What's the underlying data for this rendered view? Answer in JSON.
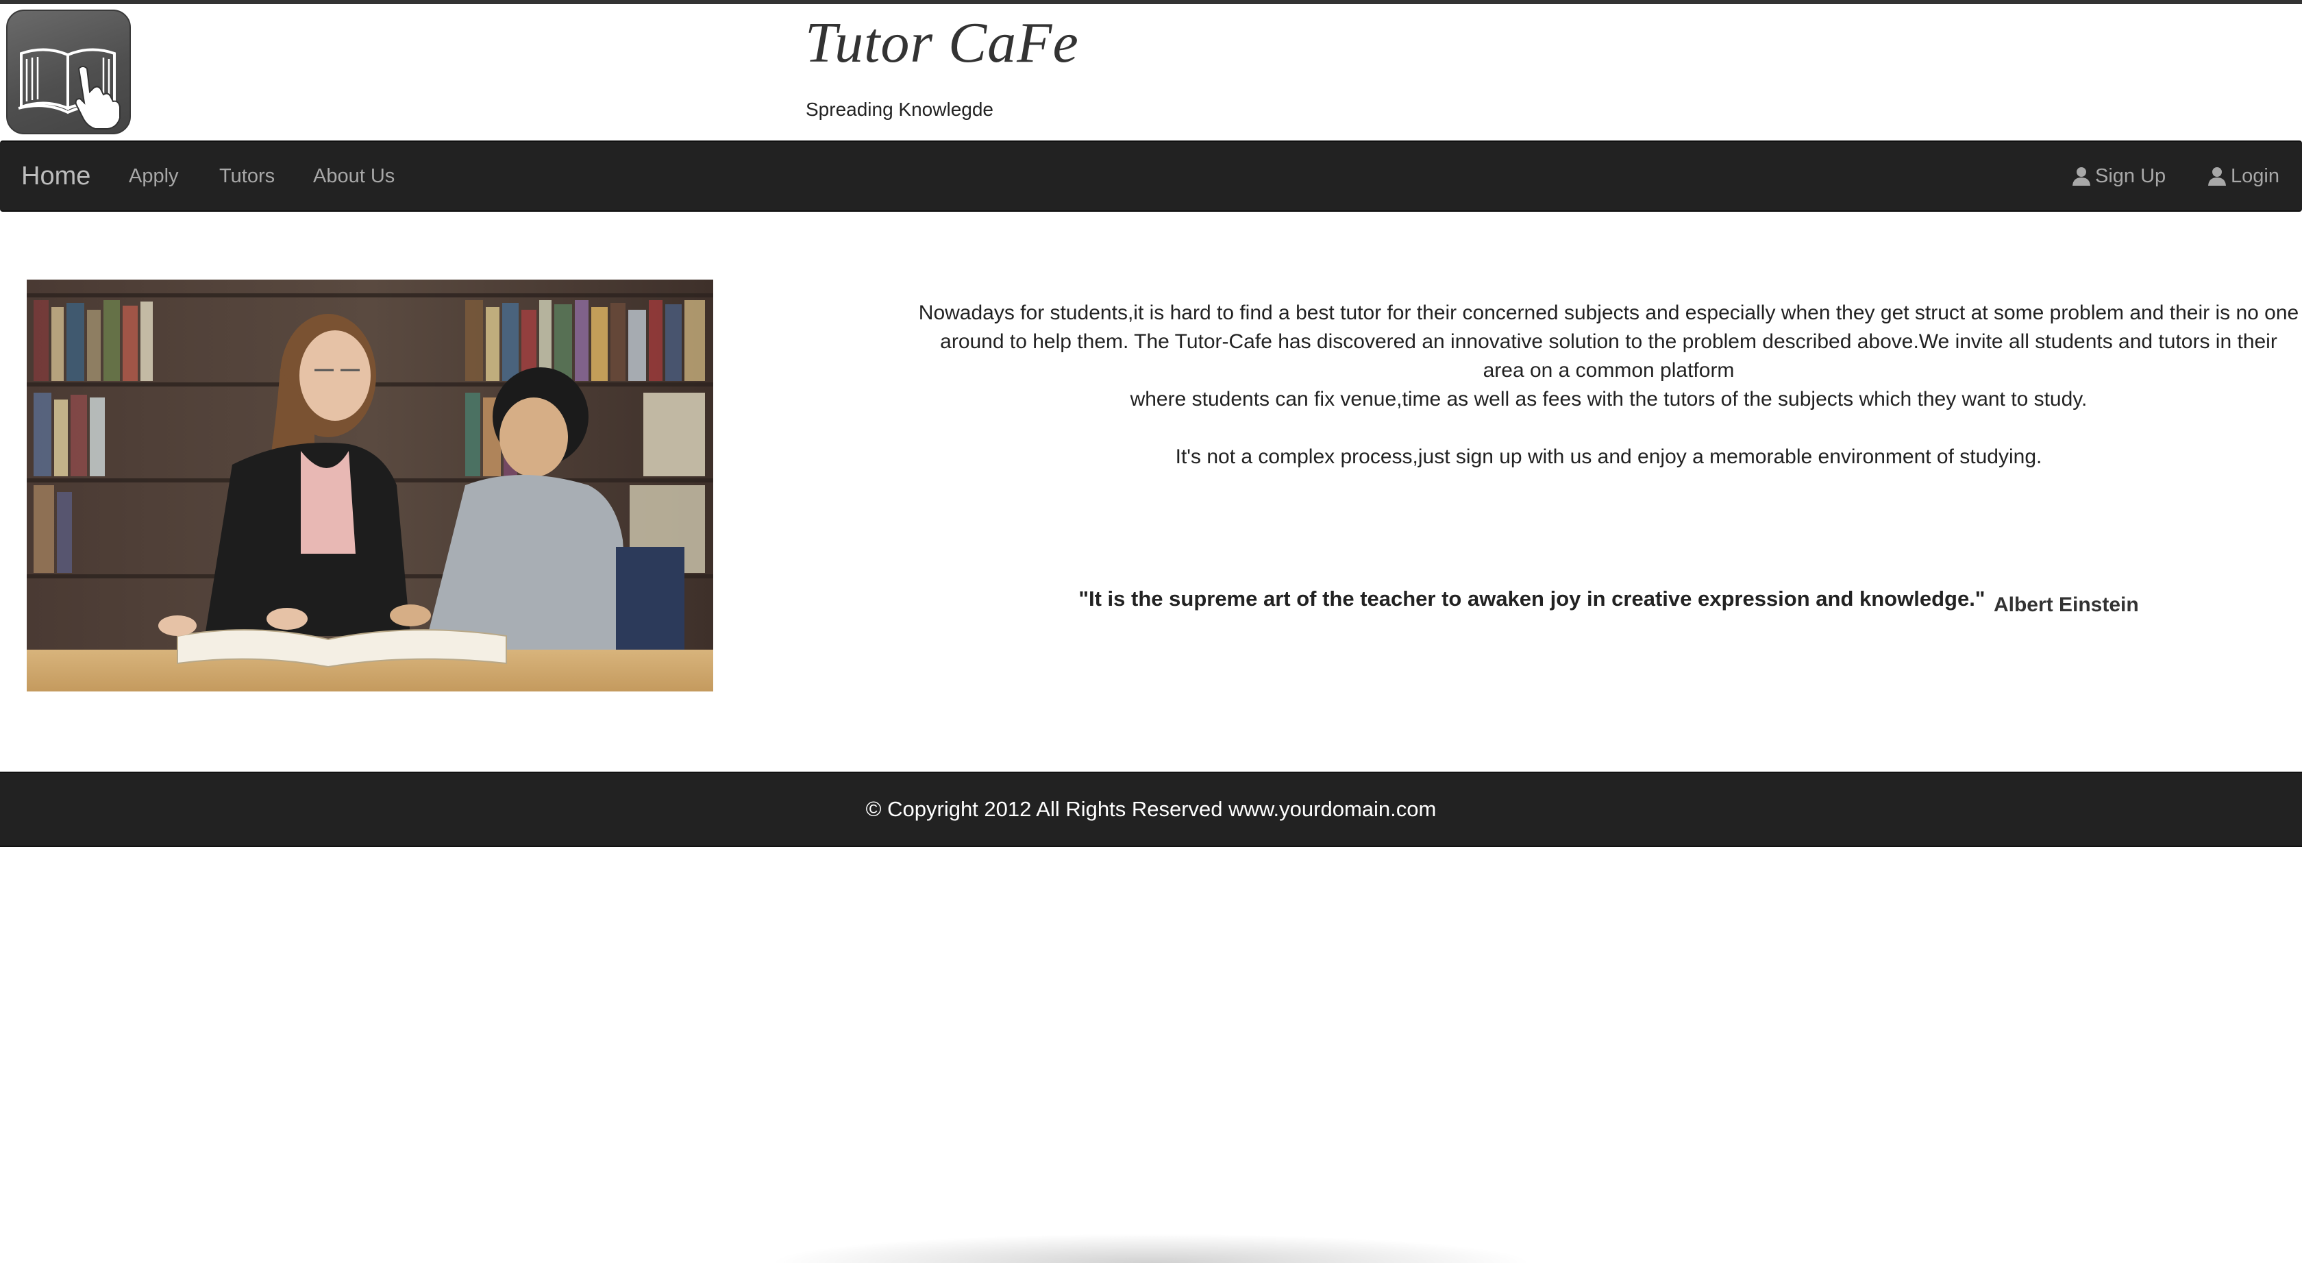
{
  "header": {
    "title": "Tutor CaFe",
    "tagline": "Spreading Knowlegde",
    "logo_icon": "book-hand-icon"
  },
  "navbar": {
    "brand": "Home",
    "items": [
      {
        "label": "Apply"
      },
      {
        "label": "Tutors"
      },
      {
        "label": "About Us"
      }
    ],
    "right_items": [
      {
        "label": "Sign Up",
        "icon": "user-icon"
      },
      {
        "label": "Login",
        "icon": "user-icon"
      }
    ]
  },
  "main": {
    "image_description": "tutor-and-student-photo",
    "intro_lines": [
      "Nowadays for students,it is hard to find a best tutor for their concerned subjects and especially when they get struct at some problem and their is no one around to help them. The Tutor-Cafe has discovered an innovative solution to the problem described above.We invite all students and tutors in their area on a common platform",
      "where students can fix venue,time as well as fees with the tutors of the subjects which they want to study."
    ],
    "intro_second": "It's not a complex process,just sign up with us and enjoy a memorable environment of studying.",
    "quote": "\"It is the supreme art of the teacher to awaken joy in creative expression and knowledge.\"",
    "quote_author": "Albert Einstein"
  },
  "footer": {
    "text": "© Copyright 2012 All Rights Reserved www.yourdomain.com"
  },
  "colors": {
    "navbar_bg": "#222222",
    "nav_text": "#a8a8a8",
    "footer_text": "#ffffff"
  }
}
